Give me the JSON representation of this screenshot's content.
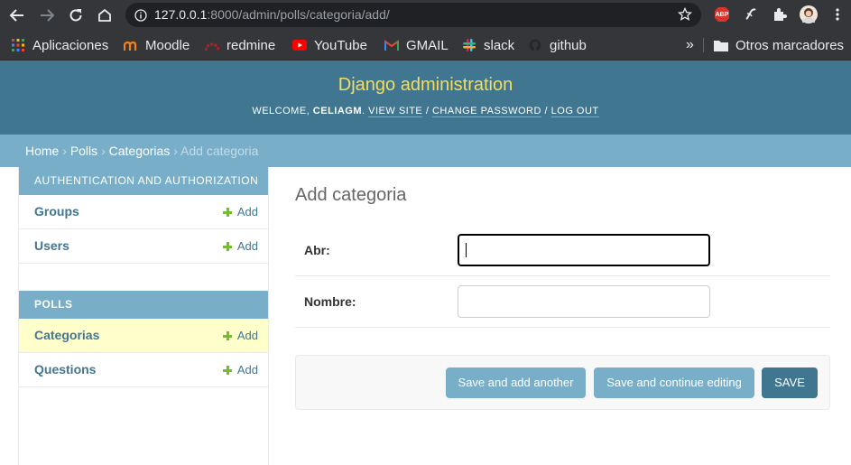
{
  "browser": {
    "url_host": "127.0.0.1",
    "url_rest": ":8000/admin/polls/categoria/add/",
    "bookmarks": [
      {
        "label": "Aplicaciones",
        "icon": "apps-grid-icon"
      },
      {
        "label": "Moodle",
        "icon": "moodle-icon"
      },
      {
        "label": "redmine",
        "icon": "redmine-icon"
      },
      {
        "label": "YouTube",
        "icon": "youtube-icon"
      },
      {
        "label": "GMAIL",
        "icon": "gmail-icon"
      },
      {
        "label": "slack",
        "icon": "slack-icon"
      },
      {
        "label": "github",
        "icon": "github-icon"
      }
    ],
    "more_bookmarks": "»",
    "other_bookmarks": "Otros marcadores",
    "abp_label": "ABP"
  },
  "header": {
    "brand": "Django administration",
    "welcome": "Welcome,",
    "username": "celiagm",
    "view_site": "View site",
    "change_password": "Change password",
    "log_out": "Log out",
    "sep": "/"
  },
  "breadcrumbs": {
    "home": "Home",
    "app": "Polls",
    "model": "Categorias",
    "current": "Add categoria",
    "sep": "›"
  },
  "sidebar": {
    "modules": [
      {
        "caption": "Authentication and Authorization",
        "items": [
          {
            "name": "Groups",
            "add": "Add"
          },
          {
            "name": "Users",
            "add": "Add"
          }
        ]
      },
      {
        "caption": "Polls",
        "items": [
          {
            "name": "Categorias",
            "add": "Add"
          },
          {
            "name": "Questions",
            "add": "Add"
          }
        ]
      }
    ]
  },
  "content": {
    "title": "Add categoria",
    "fields": [
      {
        "label": "Abr:",
        "value": ""
      },
      {
        "label": "Nombre:",
        "value": ""
      }
    ],
    "buttons": {
      "save_add_another": "Save and add another",
      "save_continue": "Save and continue editing",
      "save": "SAVE"
    }
  },
  "colors": {
    "header_bg": "#417690",
    "brand": "#f5dd5d",
    "breadcrumb_bg": "#79aec8",
    "current_row": "#ffffcc",
    "add_plus": "#70bf2b"
  }
}
